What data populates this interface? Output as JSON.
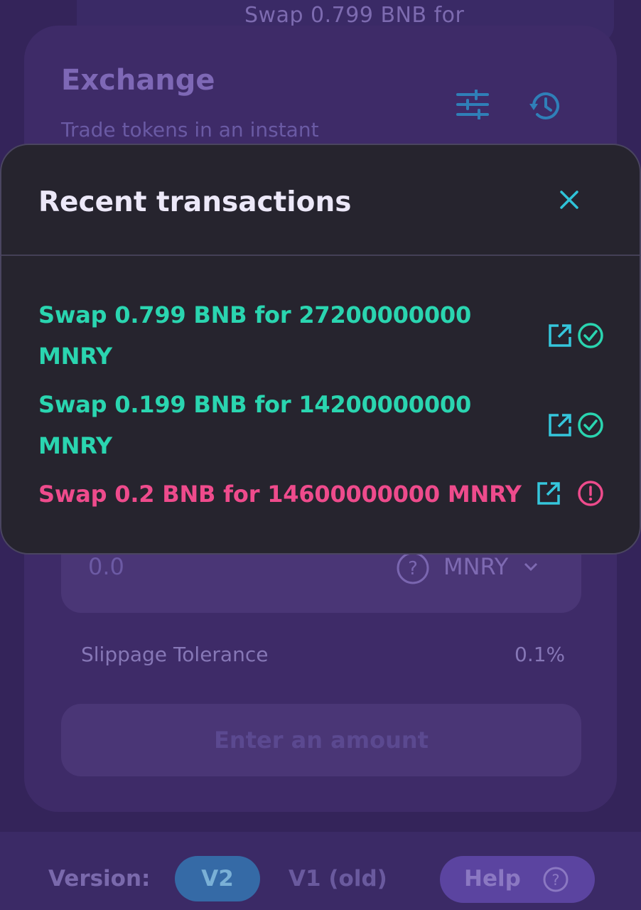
{
  "toast": {
    "text": "Swap 0.799 BNB for",
    "close_glyph": "✕"
  },
  "exchange": {
    "title": "Exchange",
    "subtitle": "Trade tokens in an instant",
    "to_value": "0.0",
    "to_token": "MNRY",
    "slippage_label": "Slippage Tolerance",
    "slippage_value": "0.1%",
    "action_button": "Enter an amount"
  },
  "modal": {
    "title": "Recent transactions",
    "transactions": [
      {
        "text": "Swap 0.799 BNB for 27200000000 MNRY",
        "status": "success",
        "status_icon": "check-circle-icon"
      },
      {
        "text": "Swap 0.199 BNB for 14200000000 MNRY",
        "status": "success",
        "status_icon": "check-circle-icon"
      },
      {
        "text": "Swap 0.2 BNB for 14600000000 MNRY",
        "status": "failed",
        "status_icon": "alert-circle-icon"
      }
    ]
  },
  "footer": {
    "version_label": "Version:",
    "v2_label": "V2",
    "v1_label": "V1 (old)",
    "help_label": "Help"
  },
  "colors": {
    "success": "#2ad5b0",
    "failed": "#ee4b8c",
    "link_icon": "#35c6dc",
    "modal_bg": "#26242e"
  }
}
